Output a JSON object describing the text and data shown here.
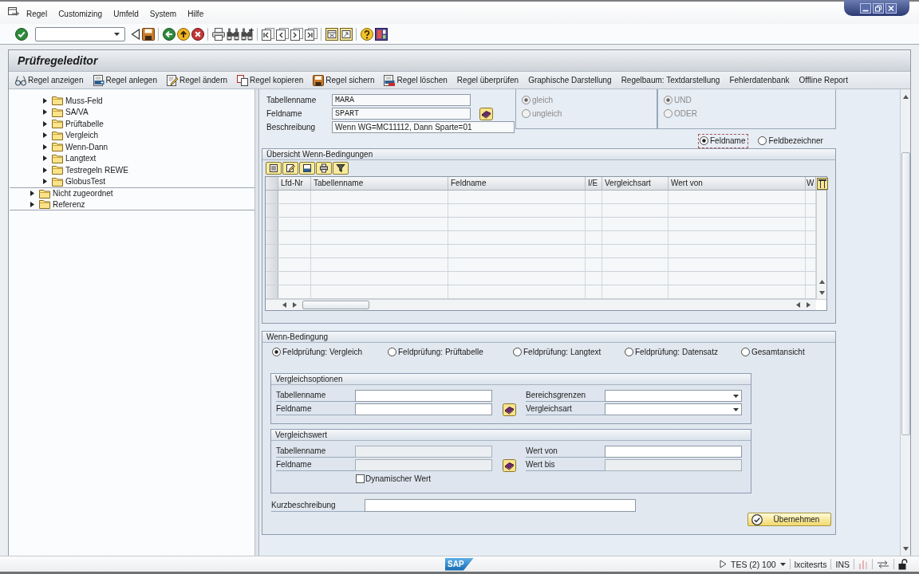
{
  "menu_bar": {
    "items": [
      "Regel",
      "Customizing",
      "Umfeld",
      "System",
      "Hilfe"
    ]
  },
  "title": "Prüfregeleditor",
  "app_toolbar": {
    "buttons": [
      {
        "label": "Regel anzeigen",
        "kind": "display"
      },
      {
        "label": "Regel anlegen",
        "kind": "create"
      },
      {
        "label": "Regel ändern",
        "kind": "change"
      },
      {
        "label": "Regel kopieren",
        "kind": "copy"
      },
      {
        "label": "Regel sichern",
        "kind": "save"
      },
      {
        "label": "Regel löschen",
        "kind": "delete"
      },
      {
        "label": "Regel überprüfen",
        "kind": "text"
      },
      {
        "label": "Graphische Darstellung",
        "kind": "text"
      },
      {
        "label": "Regelbaum: Textdarstellung",
        "kind": "text"
      },
      {
        "label": "Fehlerdatenbank",
        "kind": "text"
      },
      {
        "label": "Offline Report",
        "kind": "text"
      }
    ]
  },
  "tree": {
    "items": [
      {
        "children": [
          {
            "label": "Muss-Feld",
            "expanded": false
          },
          {
            "label": "SA/VA",
            "expanded": false
          },
          {
            "label": "Prüftabelle",
            "expanded": false
          },
          {
            "label": "Vergleich",
            "expanded": false
          },
          {
            "label": "Wenn-Dann",
            "expanded": false
          },
          {
            "label": "Langtext",
            "expanded": false
          },
          {
            "label": "Testregeln REWE",
            "expanded": false
          },
          {
            "label": "GlobusTest",
            "expanded": false
          }
        ]
      },
      {
        "label": "Nicht zugeordnet",
        "expanded": false
      },
      {
        "label": "Referenz",
        "expanded": false
      }
    ]
  },
  "rule": {
    "fields": [
      {
        "label": "Tabellenname",
        "value": "MARA",
        "value_help": false
      },
      {
        "label": "Feldname",
        "value": "SPART",
        "value_help": true
      },
      {
        "label": "Beschreibung",
        "value": "Wenn WG=MC11112, Dann Sparte=01",
        "value_help": false
      }
    ],
    "comparison": [
      {
        "label": "gleich",
        "selected": true,
        "disabled": true
      },
      {
        "label": "ungleich",
        "selected": false,
        "disabled": true
      }
    ],
    "link": [
      {
        "label": "UND",
        "selected": true,
        "disabled": true
      },
      {
        "label": "ODER",
        "selected": false,
        "disabled": true
      }
    ],
    "display": [
      {
        "label": "Feldname",
        "selected": true,
        "focused": true
      },
      {
        "label": "Feldbezeichner",
        "selected": false,
        "focused": false
      }
    ]
  },
  "overview": {
    "title": "Übersicht Wenn-Bedingungen",
    "table": {
      "columns": [
        "Lfd-Nr",
        "Tabellenname",
        "Feldname",
        "I/E",
        "Vergleichsart",
        "Wert von",
        "W"
      ]
    }
  },
  "condition": {
    "title": "Wenn-Bedingung",
    "check_types": [
      {
        "label": "Feldprüfung: Vergleich",
        "selected": true
      },
      {
        "label": "Feldprüfung: Prüftabelle",
        "selected": false
      },
      {
        "label": "Feldprüfung: Langtext",
        "selected": false
      },
      {
        "label": "Feldprüfung: Datensatz",
        "selected": false
      },
      {
        "label": "Gesamtansicht",
        "selected": false
      }
    ],
    "comparison_options": {
      "title": "Vergleichsoptionen",
      "left": [
        {
          "label": "Tabellenname",
          "kind": "input",
          "disabled": false,
          "value_help": false
        },
        {
          "label": "Feldname",
          "kind": "input",
          "disabled": false,
          "value_help": true
        }
      ],
      "right": [
        {
          "label": "Bereichsgrenzen",
          "kind": "dropdown",
          "disabled": false
        },
        {
          "label": "Vergleichsart",
          "kind": "dropdown",
          "disabled": false
        }
      ]
    },
    "comparison_value": {
      "title": "Vergleichswert",
      "left": [
        {
          "label": "Tabellenname",
          "kind": "input",
          "disabled": true,
          "value_help": false
        },
        {
          "label": "Feldname",
          "kind": "input",
          "disabled": true,
          "value_help": true
        }
      ],
      "right": [
        {
          "label": "Wert von",
          "kind": "input",
          "disabled": false
        },
        {
          "label": "Wert bis",
          "kind": "input",
          "disabled": true
        }
      ],
      "checkbox": {
        "label": "Dynamischer Wert",
        "checked": false
      }
    },
    "short_description": {
      "label": "Kurzbeschreibung"
    },
    "apply_button": {
      "label": "Übernehmen"
    }
  },
  "status_bar": {
    "logo": "SAP",
    "session": "TES (2) 100",
    "server": "lxcitesrts",
    "mode": "INS"
  }
}
